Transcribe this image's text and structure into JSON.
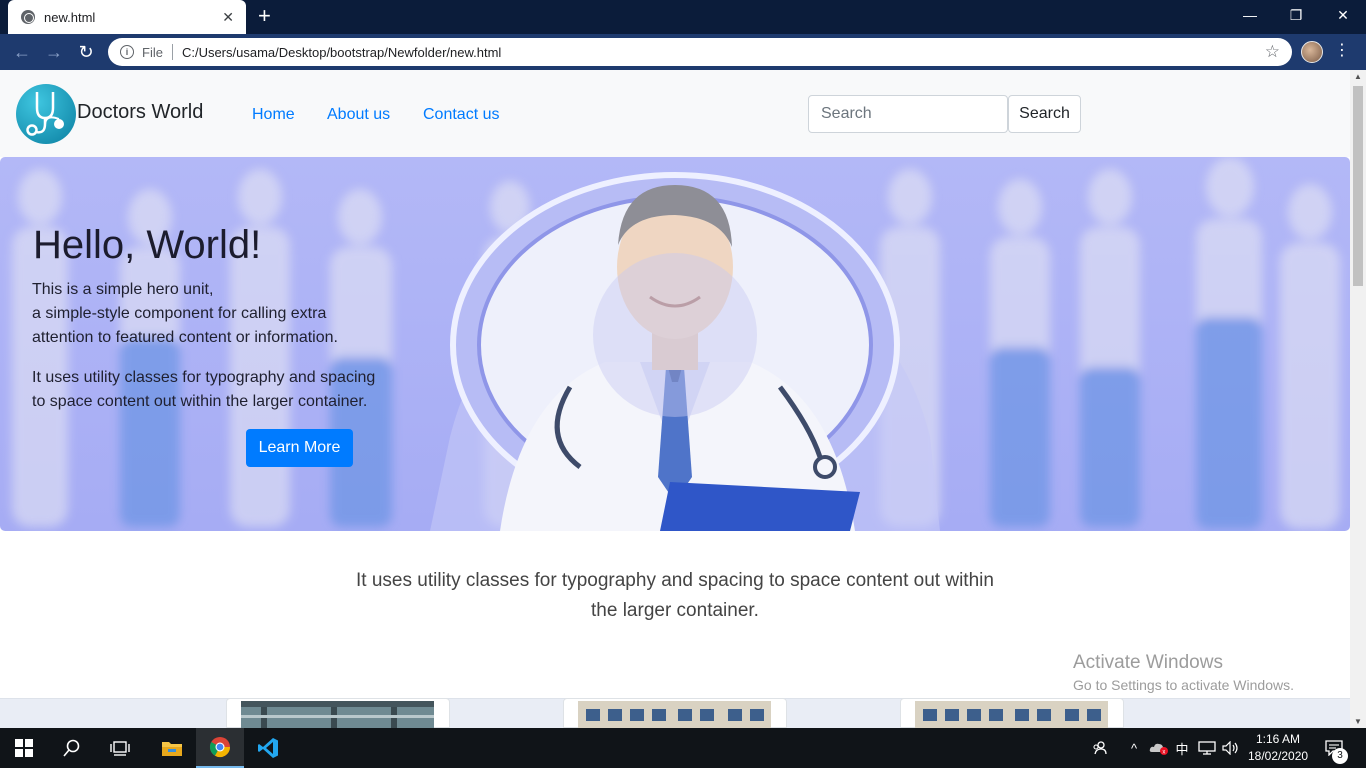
{
  "browser": {
    "tab_title": "new.html",
    "new_tab_symbol": "+",
    "url_scheme_label": "File",
    "url": "C:/Users/usama/Desktop/bootstrap/Newfolder/new.html",
    "icons": [
      "globe-icon",
      "close-icon",
      "back-icon",
      "forward-icon",
      "reload-icon",
      "info-icon",
      "star-icon",
      "avatar",
      "menu-icon",
      "minimize-icon",
      "maximize-icon",
      "close-window-icon"
    ]
  },
  "navbar": {
    "brand": "Doctors World",
    "links": [
      "Home",
      "About us",
      "Contact us"
    ],
    "search_placeholder": "Search",
    "search_button": "Search"
  },
  "hero": {
    "title": "Hello, World!",
    "lines": [
      "This is a simple hero unit,",
      "a simple-style component for calling extra",
      "attention to featured content or information.",
      "It uses utility classes for typography and spacing",
      "to space content out within the larger container."
    ],
    "button": "Learn More"
  },
  "lead": {
    "line1": "It uses utility classes for typography and spacing to space content out within",
    "line2": "the larger container."
  },
  "watermark": {
    "title": "Activate Windows",
    "subtitle": "Go to Settings to activate Windows."
  },
  "taskbar": {
    "time": "1:16 AM",
    "date": "18/02/2020",
    "notifications": "3",
    "ime": "中"
  },
  "colors": {
    "accent": "#007bff",
    "hero_bg": "#a6acf4",
    "titlebar": "#0b1c3a",
    "toolbar": "#1e3a6e"
  }
}
